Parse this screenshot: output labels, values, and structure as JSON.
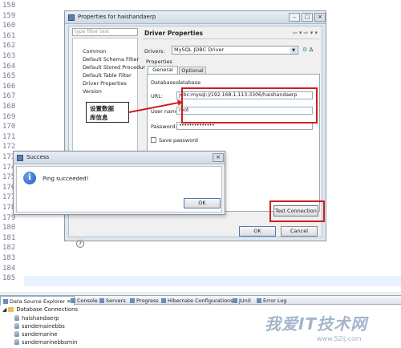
{
  "editor": {
    "line_numbers": [
      "158",
      "159",
      "160",
      "161",
      "162",
      "163",
      "164",
      "165",
      "166",
      "167",
      "168",
      "169",
      "170",
      "171",
      "172",
      "173",
      "174",
      "175",
      "176",
      "177",
      "178",
      "179",
      "180",
      "181",
      "182",
      "183",
      "184",
      "185"
    ]
  },
  "properties_dialog": {
    "title": "Properties for haishandaerp",
    "filter_placeholder": "type filter text",
    "tree_items": [
      "Common",
      "Default Schema Filter",
      "Default Stored Procedur",
      "Default Table Filter",
      "Driver Properties",
      "Version"
    ],
    "section_title": "Driver Properties",
    "nav_arrows": "⇦ ▾ ⇨ ▾ ▾",
    "drivers_label": "Drivers:",
    "drivers_value": "MySQL JDBC Driver",
    "properties_label": "Properties",
    "tabs": [
      "General",
      "Optional"
    ],
    "fields": {
      "database_label": "Database:",
      "database_value": "database",
      "url_label": "URL:",
      "url_value": "jdbc:mysql://192.168.1.113:3306/haishandaerp",
      "user_label": "User name:",
      "user_value": "root",
      "password_label": "Password:",
      "password_value": "••••••••••••••"
    },
    "save_password_label": "Save password",
    "test_connection": "Test Connection",
    "ok": "OK",
    "cancel": "Cancel",
    "help": "?"
  },
  "annotation": {
    "line1": "设置数据",
    "line2": "库信息"
  },
  "success_dialog": {
    "title": "Success",
    "message": "Ping succeeded!",
    "ok": "OK"
  },
  "bottom_tabs": [
    "Data Source Explorer",
    "Console",
    "Servers",
    "Progress",
    "Hibernate Configurations",
    "JUnit",
    "Error Log"
  ],
  "data_source_explorer": {
    "root": "Database Connections",
    "items": [
      "haishandaerp",
      "sandemainebbs",
      "sandemarine",
      "sandemarinebbsmin"
    ]
  },
  "watermark": {
    "main": "我爱IT技术网",
    "sub": "www.52ij.com"
  }
}
